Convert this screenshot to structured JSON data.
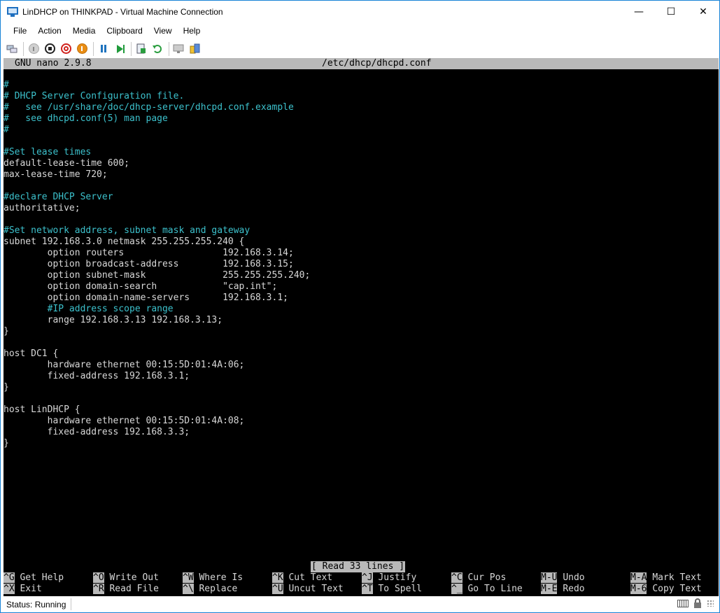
{
  "window": {
    "title": "LinDHCP on THINKPAD - Virtual Machine Connection",
    "controls": {
      "minimize": "—",
      "maximize": "☐",
      "close": "✕"
    }
  },
  "menu": [
    "File",
    "Action",
    "Media",
    "Clipboard",
    "View",
    "Help"
  ],
  "toolbar": {
    "icons": [
      "ctrl-alt-del-icon",
      "start-icon",
      "turn-off-icon",
      "shutdown-icon",
      "save-icon",
      "pause-icon",
      "resume-icon",
      "checkpoint-icon",
      "revert-icon",
      "enhanced-session-icon",
      "share-icon"
    ]
  },
  "nano": {
    "version": "GNU nano 2.9.8",
    "filename": "/etc/dhcp/dhcpd.conf",
    "lines": [
      {
        "text": "#",
        "comment": true
      },
      {
        "text": "# DHCP Server Configuration file.",
        "comment": true
      },
      {
        "text": "#   see /usr/share/doc/dhcp-server/dhcpd.conf.example",
        "comment": true
      },
      {
        "text": "#   see dhcpd.conf(5) man page",
        "comment": true
      },
      {
        "text": "#",
        "comment": true
      },
      {
        "text": "",
        "comment": false
      },
      {
        "text": "#Set lease times",
        "comment": true
      },
      {
        "text": "default-lease-time 600;",
        "comment": false
      },
      {
        "text": "max-lease-time 720;",
        "comment": false
      },
      {
        "text": "",
        "comment": false
      },
      {
        "text": "#declare DHCP Server",
        "comment": true
      },
      {
        "text": "authoritative;",
        "comment": false
      },
      {
        "text": "",
        "comment": false
      },
      {
        "text": "#Set network address, subnet mask and gateway",
        "comment": true
      },
      {
        "text": "subnet 192.168.3.0 netmask 255.255.255.240 {",
        "comment": false
      },
      {
        "text": "        option routers                  192.168.3.14;",
        "comment": false
      },
      {
        "text": "        option broadcast-address        192.168.3.15;",
        "comment": false
      },
      {
        "text": "        option subnet-mask              255.255.255.240;",
        "comment": false
      },
      {
        "text": "        option domain-search            \"cap.int\";",
        "comment": false
      },
      {
        "text": "        option domain-name-servers      192.168.3.1;",
        "comment": false
      },
      {
        "text": "        #IP address scope range",
        "comment": true
      },
      {
        "text": "        range 192.168.3.13 192.168.3.13;",
        "comment": false
      },
      {
        "text": "}",
        "comment": false
      },
      {
        "text": "",
        "comment": false
      },
      {
        "text": "host DC1 {",
        "comment": false
      },
      {
        "text": "        hardware ethernet 00:15:5D:01:4A:06;",
        "comment": false
      },
      {
        "text": "        fixed-address 192.168.3.1;",
        "comment": false
      },
      {
        "text": "}",
        "comment": false
      },
      {
        "text": "",
        "comment": false
      },
      {
        "text": "host LinDHCP {",
        "comment": false
      },
      {
        "text": "        hardware ethernet 00:15:5D:01:4A:08;",
        "comment": false
      },
      {
        "text": "        fixed-address 192.168.3.3;",
        "comment": false
      },
      {
        "text": "}",
        "comment": false
      }
    ],
    "status_message": "[ Read 33 lines ]",
    "shortcuts": [
      {
        "key": "^G",
        "label": "Get Help"
      },
      {
        "key": "^O",
        "label": "Write Out"
      },
      {
        "key": "^W",
        "label": "Where Is"
      },
      {
        "key": "^K",
        "label": "Cut Text"
      },
      {
        "key": "^J",
        "label": "Justify"
      },
      {
        "key": "^C",
        "label": "Cur Pos"
      },
      {
        "key": "M-U",
        "label": "Undo"
      },
      {
        "key": "M-A",
        "label": "Mark Text"
      },
      {
        "key": "^X",
        "label": "Exit"
      },
      {
        "key": "^R",
        "label": "Read File"
      },
      {
        "key": "^\\",
        "label": "Replace"
      },
      {
        "key": "^U",
        "label": "Uncut Text"
      },
      {
        "key": "^T",
        "label": "To Spell"
      },
      {
        "key": "^_",
        "label": "Go To Line"
      },
      {
        "key": "M-E",
        "label": "Redo"
      },
      {
        "key": "M-6",
        "label": "Copy Text"
      }
    ]
  },
  "status": {
    "text": "Status: Running"
  }
}
